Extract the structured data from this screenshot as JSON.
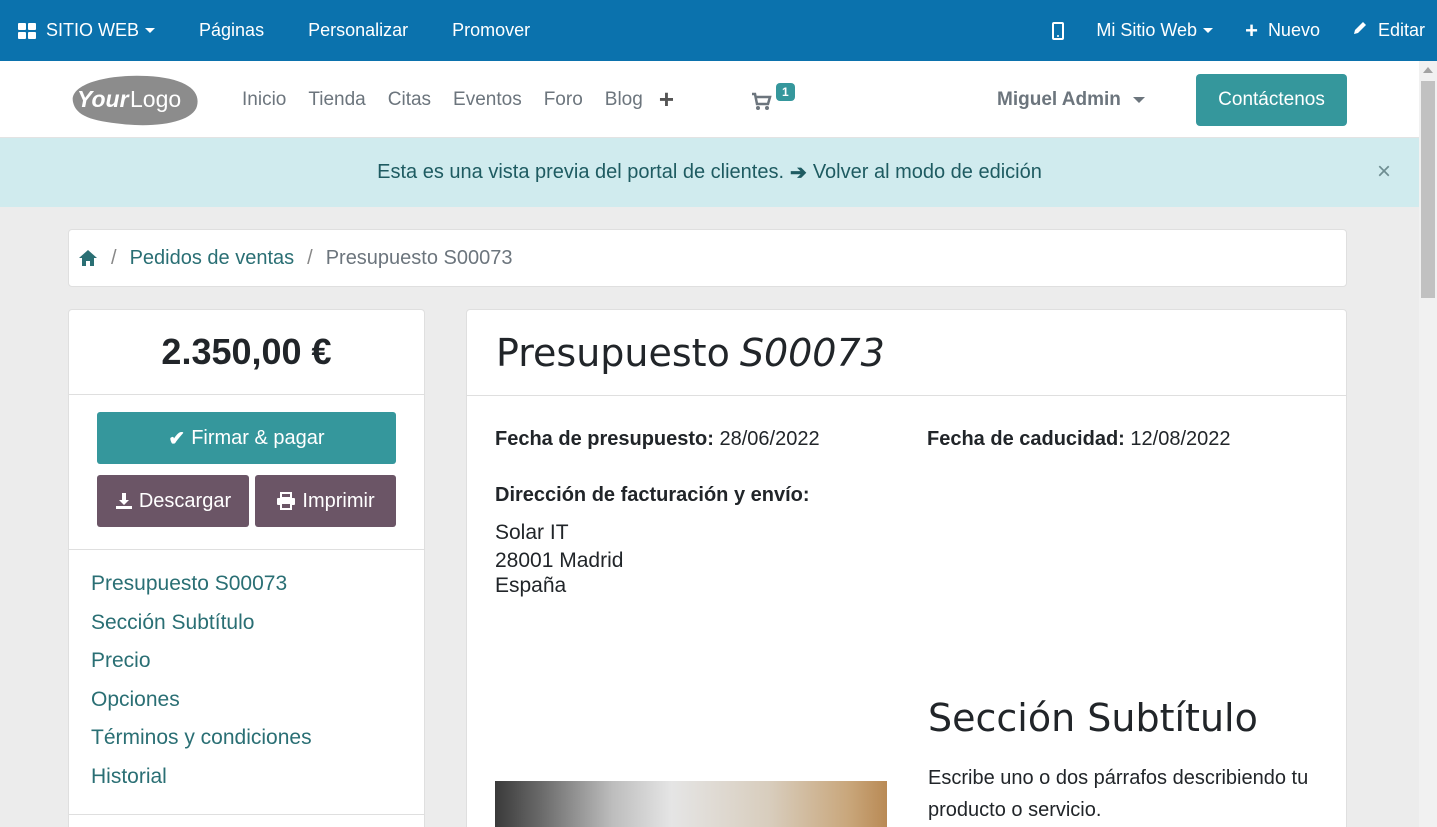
{
  "admin_bar": {
    "website_menu": "SITIO WEB",
    "pages": "Páginas",
    "customize": "Personalizar",
    "promote": "Promover",
    "site_selector": "Mi Sitio Web",
    "new": "Nuevo",
    "edit": "Editar",
    "color": "#0b72ad"
  },
  "header": {
    "logo_text": "YourLogo",
    "nav": [
      "Inicio",
      "Tienda",
      "Citas",
      "Eventos",
      "Foro",
      "Blog"
    ],
    "cart_count": "1",
    "user": "Miguel Admin",
    "contact_button": "Contáctenos",
    "accent_color": "#35979c"
  },
  "alert": {
    "message": "Esta es una vista previa del portal de clientes.",
    "link": "Volver al modo de edición",
    "close": "×"
  },
  "breadcrumb": {
    "items": [
      "Pedidos de ventas",
      "Presupuesto S00073"
    ]
  },
  "sidebar": {
    "amount": "2.350,00 €",
    "sign_pay": "Firmar & pagar",
    "download": "Descargar",
    "print": "Imprimir",
    "toc": [
      "Presupuesto S00073",
      "Sección Subtítulo",
      "Precio",
      "Opciones",
      "Términos y condiciones",
      "Historial"
    ]
  },
  "quote": {
    "title_prefix": "Presupuesto",
    "title_number": "S00073",
    "date_label": "Fecha de presupuesto:",
    "date_value": "28/06/2022",
    "expiry_label": "Fecha de caducidad:",
    "expiry_value": "12/08/2022",
    "address_label": "Dirección de facturación y envío:",
    "address_lines": [
      "Solar IT",
      "28001 Madrid",
      "España"
    ],
    "section_title": "Sección Subtítulo",
    "section_text": "Escribe uno o dos párrafos describiendo tu producto o servicio."
  }
}
